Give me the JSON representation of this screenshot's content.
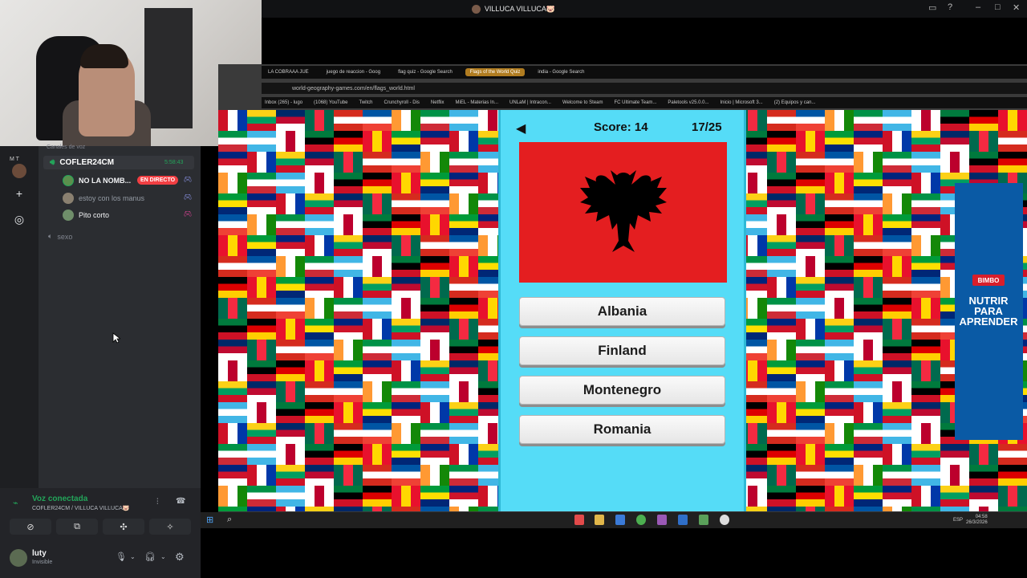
{
  "window": {
    "title": "VILLUCA VILLUCA🐷"
  },
  "discord": {
    "channel_header": "Canales de voz",
    "voice_channel": {
      "name": "COFLER24CM",
      "timer": "5:58:43"
    },
    "members": [
      {
        "name": "NO LA NOMB...",
        "badge": "EN DIRECTO"
      },
      {
        "name": "estoy con los manus"
      },
      {
        "name": "Pito corto"
      }
    ],
    "other_channel": "sexo",
    "rail_letters": "M T",
    "voice_status": {
      "title": "Voz conectada",
      "subtitle": "COFLER24CM / VILLUCA VILLUCA🐷"
    },
    "user": {
      "name": "luty",
      "status": "Invisible"
    }
  },
  "browser": {
    "tabs": [
      "LA COBRAAA JUE",
      "juego de reaccion - Goog",
      "flag quiz - Google Search",
      "Flags of the World Quiz",
      "india - Google Search"
    ],
    "active_tab_index": 3,
    "url": "world-geography-games.com/en/flags_world.html",
    "bookmarks": [
      "Inbox (265) - lugo",
      "(1068) YouTube",
      "Twitch",
      "Crunchyroll - Dis",
      "Netflix",
      "MiEL - Materias In...",
      "UNLaM | Intracon...",
      "Welcome to Steam",
      "FC Ultimate Team...",
      "Paletools v25.0.0...",
      "Inicio | Microsoft 3...",
      "(2) Equipos y can..."
    ]
  },
  "quiz": {
    "score_label": "Score: 14",
    "progress_label": "17/25",
    "flag_colors": {
      "field": "#e41e20",
      "eagle": "#000000"
    },
    "answers": [
      "Albania",
      "Finland",
      "Montenegro",
      "Romania"
    ]
  },
  "ad": {
    "brand": "BIMBO",
    "headline": "NUTRIR PARA APRENDER"
  },
  "taskbar": {
    "lang": "ESP",
    "time": "04:58",
    "date": "26/3/2026"
  }
}
